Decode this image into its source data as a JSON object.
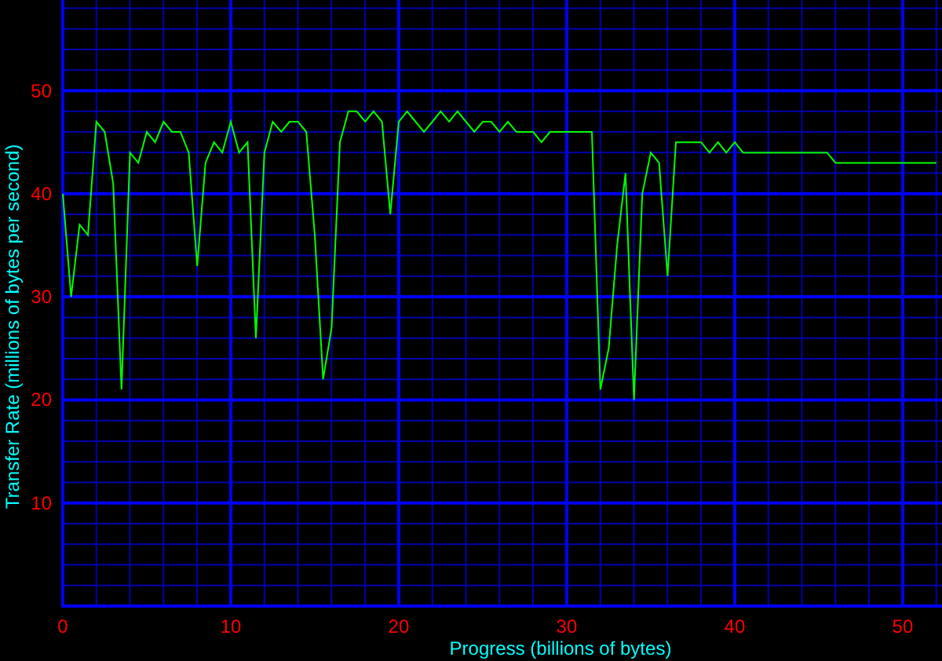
{
  "chart": {
    "chart_data": {
      "type": "line",
      "xlabel": "Progress (billions of bytes)",
      "ylabel": "Transfer Rate (millions of bytes per second)",
      "x": [
        0,
        0.5,
        1,
        1.5,
        2,
        2.5,
        3,
        3.5,
        4,
        4.5,
        5,
        5.5,
        6,
        6.5,
        7,
        7.5,
        8,
        8.5,
        9,
        9.5,
        10,
        10.5,
        11,
        11.5,
        12,
        12.5,
        13,
        13.5,
        14,
        14.5,
        15,
        15.5,
        16,
        16.5,
        17,
        17.5,
        18,
        18.5,
        19,
        19.5,
        20,
        20.5,
        21,
        21.5,
        22,
        22.5,
        23,
        23.5,
        24,
        24.5,
        25,
        25.5,
        26,
        26.5,
        27,
        27.5,
        28,
        28.5,
        29,
        29.5,
        30,
        30.5,
        31,
        31.5,
        32,
        32.5,
        33,
        33.5,
        34,
        34.5,
        35,
        35.5,
        36,
        36.5,
        37,
        37.5,
        38,
        38.5,
        39,
        39.5,
        40,
        40.5,
        41,
        41.5,
        42,
        42.5,
        43,
        43.5,
        44,
        44.5,
        45,
        45.5,
        46,
        46.5,
        47,
        47.5,
        48,
        48.5,
        49,
        49.5,
        50,
        50.5,
        51,
        51.5,
        52
      ],
      "series": [
        {
          "color": "#00ff00",
          "values": [
            40,
            30,
            37,
            36,
            47,
            46,
            41,
            21,
            44,
            43,
            46,
            45,
            47,
            46,
            46,
            44,
            33,
            43,
            45,
            44,
            47,
            44,
            45,
            26,
            44,
            47,
            46,
            47,
            47,
            46,
            36,
            22,
            27,
            45,
            48,
            48,
            47,
            48,
            47,
            38,
            47,
            48,
            47,
            46,
            47,
            48,
            47,
            48,
            47,
            46,
            47,
            47,
            46,
            47,
            46,
            46,
            46,
            45,
            46,
            46,
            46,
            46,
            46,
            46,
            21,
            25,
            35,
            42,
            20,
            40,
            44,
            43,
            32,
            45,
            45,
            45,
            45,
            44,
            45,
            44,
            45,
            44,
            44,
            44,
            44,
            44,
            44,
            44,
            44,
            44,
            44,
            44,
            43,
            43,
            43,
            43,
            43,
            43,
            43,
            43,
            43,
            43,
            43,
            43,
            43
          ]
        }
      ],
      "grid": true,
      "xlim": [
        0,
        52.34
      ],
      "ylim": [
        0,
        58.8
      ],
      "xticks": [
        0,
        10,
        20,
        30,
        40,
        50
      ],
      "yticks": [
        10,
        20,
        30,
        40,
        50
      ]
    }
  }
}
